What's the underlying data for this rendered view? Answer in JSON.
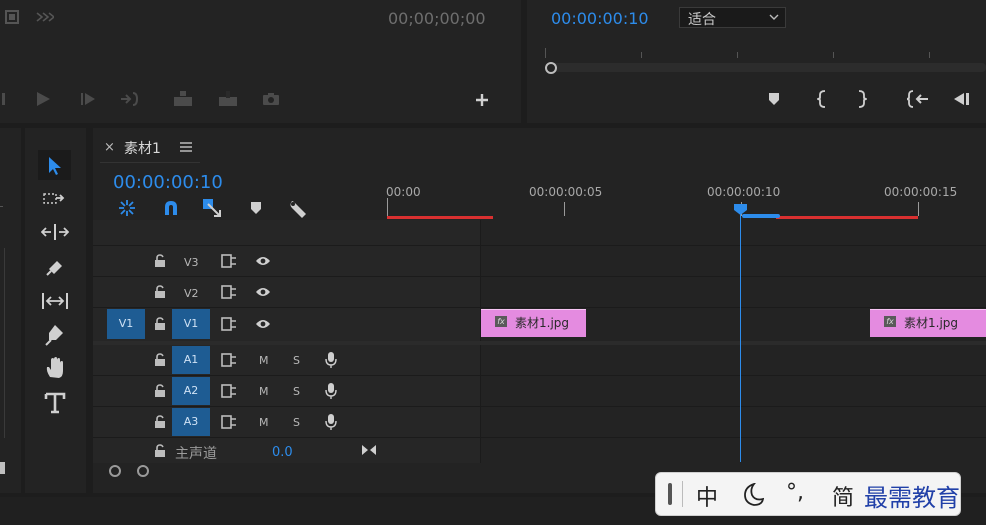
{
  "source_monitor": {
    "timecode": "00;00;00;00"
  },
  "program_monitor": {
    "timecode": "00:00:00:10",
    "zoom": "适合"
  },
  "timeline": {
    "tab_title": "素材1",
    "timecode": "00:00:00:10",
    "ruler": [
      "00:00",
      "00:00:00:05",
      "00:00:00:10",
      "00:00:00:15"
    ],
    "tracks_video": [
      {
        "id": "V3"
      },
      {
        "id": "V2"
      },
      {
        "id": "V1",
        "source": "V1"
      }
    ],
    "tracks_audio": [
      {
        "id": "A1",
        "m": "M",
        "s": "S"
      },
      {
        "id": "A2",
        "m": "M",
        "s": "S"
      },
      {
        "id": "A3",
        "m": "M",
        "s": "S"
      }
    ],
    "master": {
      "label": "主声道",
      "value": "0.0"
    },
    "clips": [
      {
        "name": "素材1.jpg",
        "fx": "fx"
      },
      {
        "name": "素材1.jpg",
        "fx": "fx"
      }
    ]
  },
  "ime": {
    "mode": "中",
    "punct": "°,",
    "simplified": "简"
  },
  "watermark": "最需教育",
  "colors": {
    "accent": "#2d8ceb",
    "clip": "#e48be0",
    "track_target": "#1e5c93",
    "inout": "#d93030"
  },
  "icons": [
    "selection-tool-icon",
    "track-select-icon",
    "ripple-edit-icon",
    "razor-icon",
    "slip-icon",
    "pen-icon",
    "hand-icon",
    "type-icon",
    "lock-icon",
    "camera-icon",
    "eye-icon",
    "mic-icon",
    "wrench-icon",
    "marker-icon",
    "magnet-icon"
  ]
}
